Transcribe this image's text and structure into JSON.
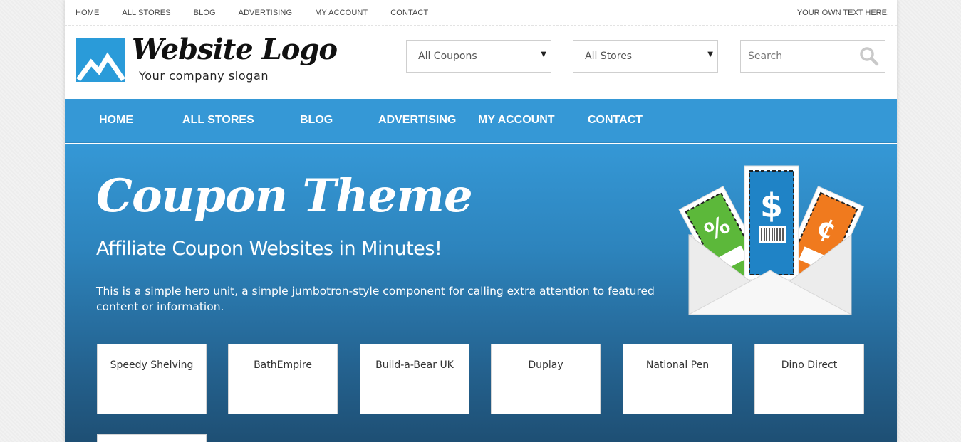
{
  "topbar": {
    "links": [
      "HOME",
      "ALL STORES",
      "BLOG",
      "ADVERTISING",
      "MY ACCOUNT",
      "CONTACT"
    ],
    "right_text": "YOUR OWN TEXT HERE."
  },
  "header": {
    "logo_title": "Website Logo",
    "logo_slogan": "Your company slogan",
    "coupons_select": "All Coupons",
    "stores_select": "All Stores",
    "search_placeholder": "Search"
  },
  "mainnav": {
    "items": [
      "HOME",
      "ALL STORES",
      "BLOG",
      "ADVERTISING",
      "MY ACCOUNT",
      "CONTACT"
    ]
  },
  "hero": {
    "title": "Coupon Theme",
    "subtitle": "Affiliate Coupon Websites in Minutes!",
    "description": "This is a simple hero unit, a simple jumbotron-style component for calling extra attention to featured content or information.",
    "coupon_symbols": [
      "%",
      "$",
      "¢"
    ]
  },
  "stores": [
    "Speedy Shelving",
    "BathEmpire",
    "Build-a-Bear UK",
    "Duplay",
    "National Pen",
    "Dino Direct",
    ""
  ],
  "colors": {
    "accent": "#3598d6",
    "hero_bottom": "#1e4f74",
    "coupon_green": "#5cb83a",
    "coupon_blue": "#1f83c6",
    "coupon_orange": "#f07a1e"
  }
}
